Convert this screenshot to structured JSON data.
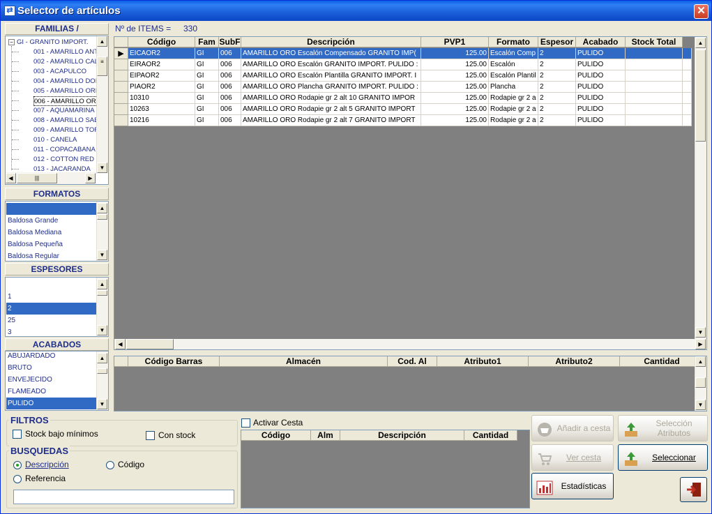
{
  "window": {
    "title": "Selector de artículos",
    "close_glyph": "✕"
  },
  "families": {
    "header": "FAMILIAS / SUBFAMILIAS",
    "root": "GI - GRANITO IMPORT.",
    "items": [
      "001 - AMARILLO ANT",
      "002 - AMARILLO CAL",
      "003 - ACAPULCO",
      "004 - AMARILLO DOI",
      "005 - AMARILLO ORI",
      "006 - AMARILLO ORO",
      "007 - AQUAMARINA",
      "008 - AMARILLO SAE",
      "009 - AMARILLO TOF",
      "010 - CANELA",
      "011 - COPACABANA",
      "012 - COTTON RED",
      "013 - JACARANDA"
    ],
    "selected_index": 5
  },
  "formatos": {
    "header": "FORMATOS",
    "items": [
      "",
      "Baldosa Grande",
      "Baldosa Mediana",
      "Baldosa Pequeña",
      "Baldosa Regular"
    ],
    "selected_index": 0
  },
  "espesores": {
    "header": "ESPESORES",
    "items": [
      "",
      "1",
      "2",
      "25",
      "3"
    ],
    "selected_index": 2
  },
  "acabados": {
    "header": "ACABADOS",
    "items": [
      "ABUJARDADO",
      "BRUTO",
      "ENVEJECIDO",
      "FLAMEADO",
      "PULIDO"
    ],
    "selected_index": 4
  },
  "items_count": {
    "label": "Nº de ITEMS =",
    "value": "330"
  },
  "main_grid": {
    "columns": [
      "Código",
      "Fam",
      "SubF",
      "Descripción",
      "PVP1",
      "Formato",
      "Espesor",
      "Acabado",
      "Stock Total"
    ],
    "rows": [
      [
        "EICAOR2",
        "GI",
        "006",
        "AMARILLO ORO Escalón Compensado GRANITO IMP(",
        "125.00",
        "Escalón Comp",
        "2",
        "PULIDO",
        ""
      ],
      [
        "EIRAOR2",
        "GI",
        "006",
        "AMARILLO ORO Escalón GRANITO IMPORT. PULIDO :",
        "125.00",
        "Escalón",
        "2",
        "PULIDO",
        ""
      ],
      [
        "EIPAOR2",
        "GI",
        "006",
        "AMARILLO ORO Escalón Plantilla GRANITO IMPORT. I",
        "125.00",
        "Escalón Plantil",
        "2",
        "PULIDO",
        ""
      ],
      [
        "PIAOR2",
        "GI",
        "006",
        "AMARILLO ORO Plancha GRANITO IMPORT. PULIDO :",
        "125.00",
        "Plancha",
        "2",
        "PULIDO",
        ""
      ],
      [
        "10310",
        "GI",
        "006",
        "AMARILLO ORO Rodapie gr 2 alt 10 GRANITO IMPOR",
        "125.00",
        "Rodapie gr 2 a",
        "2",
        "PULIDO",
        ""
      ],
      [
        "10263",
        "GI",
        "006",
        "AMARILLO ORO Rodapie gr 2 alt 5 GRANITO IMPORT",
        "125.00",
        "Rodapie gr 2 a",
        "2",
        "PULIDO",
        ""
      ],
      [
        "10216",
        "GI",
        "006",
        "AMARILLO ORO Rodapie gr 2 alt 7 GRANITO IMPORT",
        "125.00",
        "Rodapie gr 2 a",
        "2",
        "PULIDO",
        ""
      ]
    ],
    "selected_row": 0,
    "row_indicator": "▶"
  },
  "detail_grid": {
    "columns": [
      "Código Barras",
      "Almacén",
      "Cod. Al",
      "Atributo1",
      "Atributo2",
      "Cantidad"
    ]
  },
  "filtros": {
    "title": "FILTROS",
    "stock_bajo": "Stock bajo mínimos",
    "con_stock": "Con stock"
  },
  "busquedas": {
    "title": "BUSQUEDAS",
    "descripcion": "Descripción",
    "codigo": "Código",
    "referencia": "Referencia",
    "search_value": ""
  },
  "cesta": {
    "activar": "Activar Cesta",
    "columns": [
      "Código",
      "Alm",
      "Descripción",
      "Cantidad"
    ]
  },
  "buttons": {
    "anadir": "Añadir a cesta",
    "seleccion_atributos": "Selección Atributos",
    "ver_cesta": "Ver cesta",
    "seleccionar": "Seleccionar",
    "estadisticas": "Estadísticas"
  },
  "colors": {
    "selection": "#316AC5",
    "header_text": "#1F2D8A",
    "grid_bg": "#808080"
  }
}
